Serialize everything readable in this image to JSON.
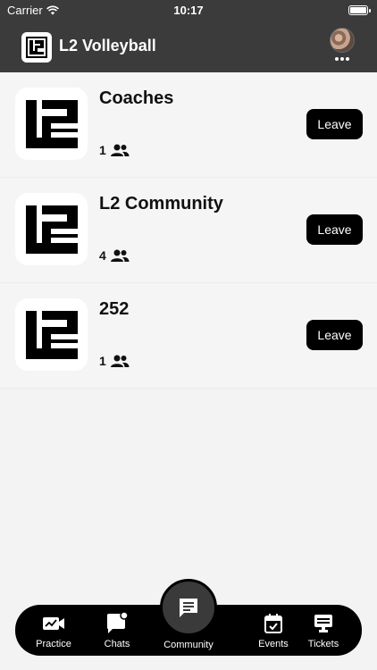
{
  "status_bar": {
    "carrier": "Carrier",
    "time": "10:17"
  },
  "header": {
    "title": "L2 Volleyball"
  },
  "communities": [
    {
      "name": "Coaches",
      "members": "1",
      "action": "Leave"
    },
    {
      "name": "L2 Community",
      "members": "4",
      "action": "Leave"
    },
    {
      "name": "252",
      "members": "1",
      "action": "Leave"
    }
  ],
  "tabs": [
    {
      "label": "Practice",
      "icon": "video-chart-icon"
    },
    {
      "label": "Chats",
      "icon": "chat-bubble-icon"
    },
    {
      "label": "Community",
      "icon": "message-icon",
      "active": true
    },
    {
      "label": "Events",
      "icon": "calendar-check-icon"
    },
    {
      "label": "Tickets",
      "icon": "ticket-icon"
    }
  ],
  "colors": {
    "header_bg": "#3b3b3b",
    "tab_bar_bg": "#000000",
    "button_bg": "#000000",
    "list_bg": "#f5f5f5"
  }
}
